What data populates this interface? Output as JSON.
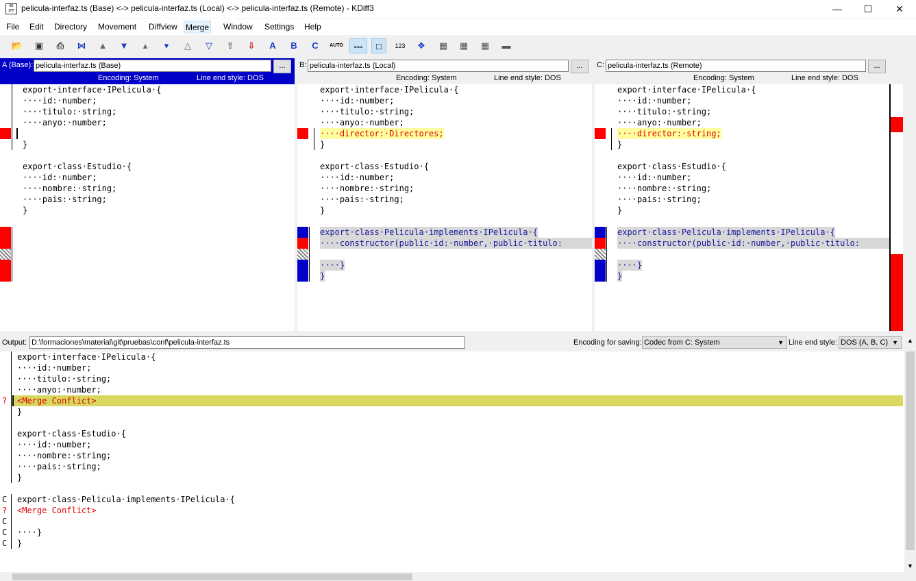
{
  "window": {
    "title": "pelicula-interfaz.ts (Base) <-> pelicula-interfaz.ts (Local) <-> pelicula-interfaz.ts (Remote) - KDiff3",
    "logo_text": "KDIFF3"
  },
  "menu": [
    "File",
    "Edit",
    "Directory",
    "Movement",
    "Diffview",
    "Merge",
    "Window",
    "Settings",
    "Help"
  ],
  "toolbar": {
    "auto_label": "AUTO",
    "num_label": "123",
    "a_label": "A",
    "b_label": "B",
    "c_label": "C"
  },
  "panes": {
    "a": {
      "label": "A (Base):",
      "file": "pelicula-interfaz.ts (Base)",
      "browse": "...",
      "encoding": "Encoding: System",
      "line_end": "Line end style: DOS"
    },
    "b": {
      "label": "B:",
      "file": "pelicula-interfaz.ts (Local)",
      "browse": "...",
      "encoding": "Encoding: System",
      "line_end": "Line end style: DOS"
    },
    "c": {
      "label": "C:",
      "file": "pelicula-interfaz.ts (Remote)",
      "browse": "...",
      "encoding": "Encoding: System",
      "line_end": "Line end style: DOS"
    }
  },
  "code": {
    "a": [
      "export·interface·IPelicula·{",
      "····id:·number;",
      "····titulo:·string;",
      "····anyo:·number;",
      "",
      "}",
      "",
      "export·class·Estudio·{",
      "····id:·number;",
      "····nombre:·string;",
      "····pais:·string;",
      "}"
    ],
    "b": [
      "export·interface·IPelicula·{",
      "····id:·number;",
      "····titulo:·string;",
      "····anyo:·number;",
      "····director:·Directores;",
      "}",
      "",
      "export·class·Estudio·{",
      "····id:·number;",
      "····nombre:·string;",
      "····pais:·string;",
      "}",
      "",
      "export·class·Pelicula·implements·IPelicula·{",
      "····constructor(public·id:·number,·public·titulo:",
      "",
      "····}",
      "}"
    ],
    "c": [
      "export·interface·IPelicula·{",
      "····id:·number;",
      "····titulo:·string;",
      "····anyo:·number;",
      "····director:·string;",
      "}",
      "",
      "export·class·Estudio·{",
      "····id:·number;",
      "····nombre:·string;",
      "····pais:·string;",
      "}",
      "",
      "export·class·Pelicula·implements·IPelicula·{",
      "····constructor(public·id:·number,·public·titulo:",
      "",
      "····}",
      "}"
    ]
  },
  "output": {
    "label": "Output:",
    "path": "D:\\formaciones\\material\\git\\pruebas\\conf\\pelicula-interfaz.ts",
    "encoding_label": "Encoding for saving:",
    "encoding_value": "Codec from C: System",
    "line_end_label": "Line end style:",
    "line_end_value": "DOS (A, B, C)",
    "lines": [
      {
        "mark": "",
        "text": "export·interface·IPelicula·{"
      },
      {
        "mark": "",
        "text": "····id:·number;"
      },
      {
        "mark": "",
        "text": "····titulo:·string;"
      },
      {
        "mark": "",
        "text": "····anyo:·number;"
      },
      {
        "mark": "?",
        "text": "<Merge Conflict>"
      },
      {
        "mark": "",
        "text": "}"
      },
      {
        "mark": "",
        "text": ""
      },
      {
        "mark": "",
        "text": "export·class·Estudio·{"
      },
      {
        "mark": "",
        "text": "····id:·number;"
      },
      {
        "mark": "",
        "text": "····nombre:·string;"
      },
      {
        "mark": "",
        "text": "····pais:·string;"
      },
      {
        "mark": "",
        "text": "}"
      },
      {
        "mark": "",
        "text": ""
      },
      {
        "mark": "C",
        "text": "export·class·Pelicula·implements·IPelicula·{"
      },
      {
        "mark": "?",
        "text": "<Merge Conflict>"
      },
      {
        "mark": "C",
        "text": ""
      },
      {
        "mark": "C",
        "text": "····}"
      },
      {
        "mark": "C",
        "text": "}"
      }
    ]
  },
  "colors": {
    "active_header": "#0000c8",
    "conflict_red": "#ff0000",
    "diff_blue": "#0000c8",
    "conflict_line": "#d8d860"
  }
}
